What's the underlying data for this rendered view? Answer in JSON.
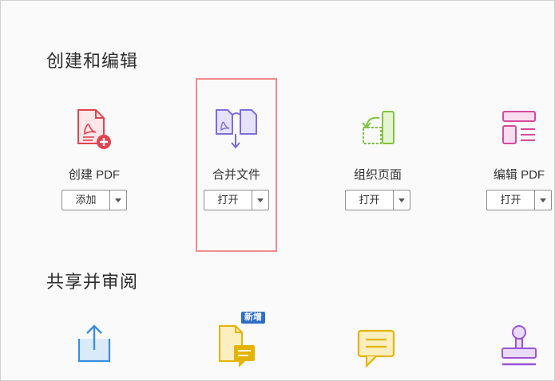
{
  "sections": {
    "create_edit": {
      "title": "创建和编辑"
    },
    "share_review": {
      "title": "共享并审阅"
    }
  },
  "tools": [
    {
      "label": "创建 PDF",
      "button": "添加",
      "icon": "create-pdf-icon"
    },
    {
      "label": "合并文件",
      "button": "打开",
      "icon": "combine-files-icon"
    },
    {
      "label": "组织页面",
      "button": "打开",
      "icon": "organize-pages-icon"
    },
    {
      "label": "编辑 PDF",
      "button": "打开",
      "icon": "edit-pdf-icon"
    }
  ],
  "share_tools": [
    {
      "icon": "share-icon"
    },
    {
      "icon": "send-for-comments-icon",
      "badge": "新增"
    },
    {
      "icon": "comment-icon"
    },
    {
      "icon": "stamp-icon"
    }
  ],
  "colors": {
    "create_pdf": "#e0454f",
    "combine": "#7b6fd6",
    "organize": "#7fc241",
    "edit_pdf": "#d44a9c",
    "share": "#3a8ee0",
    "comments": "#e4b400",
    "stamp": "#9a55d6",
    "highlight": "#f08c8c",
    "badge": "#2d6fc9"
  }
}
